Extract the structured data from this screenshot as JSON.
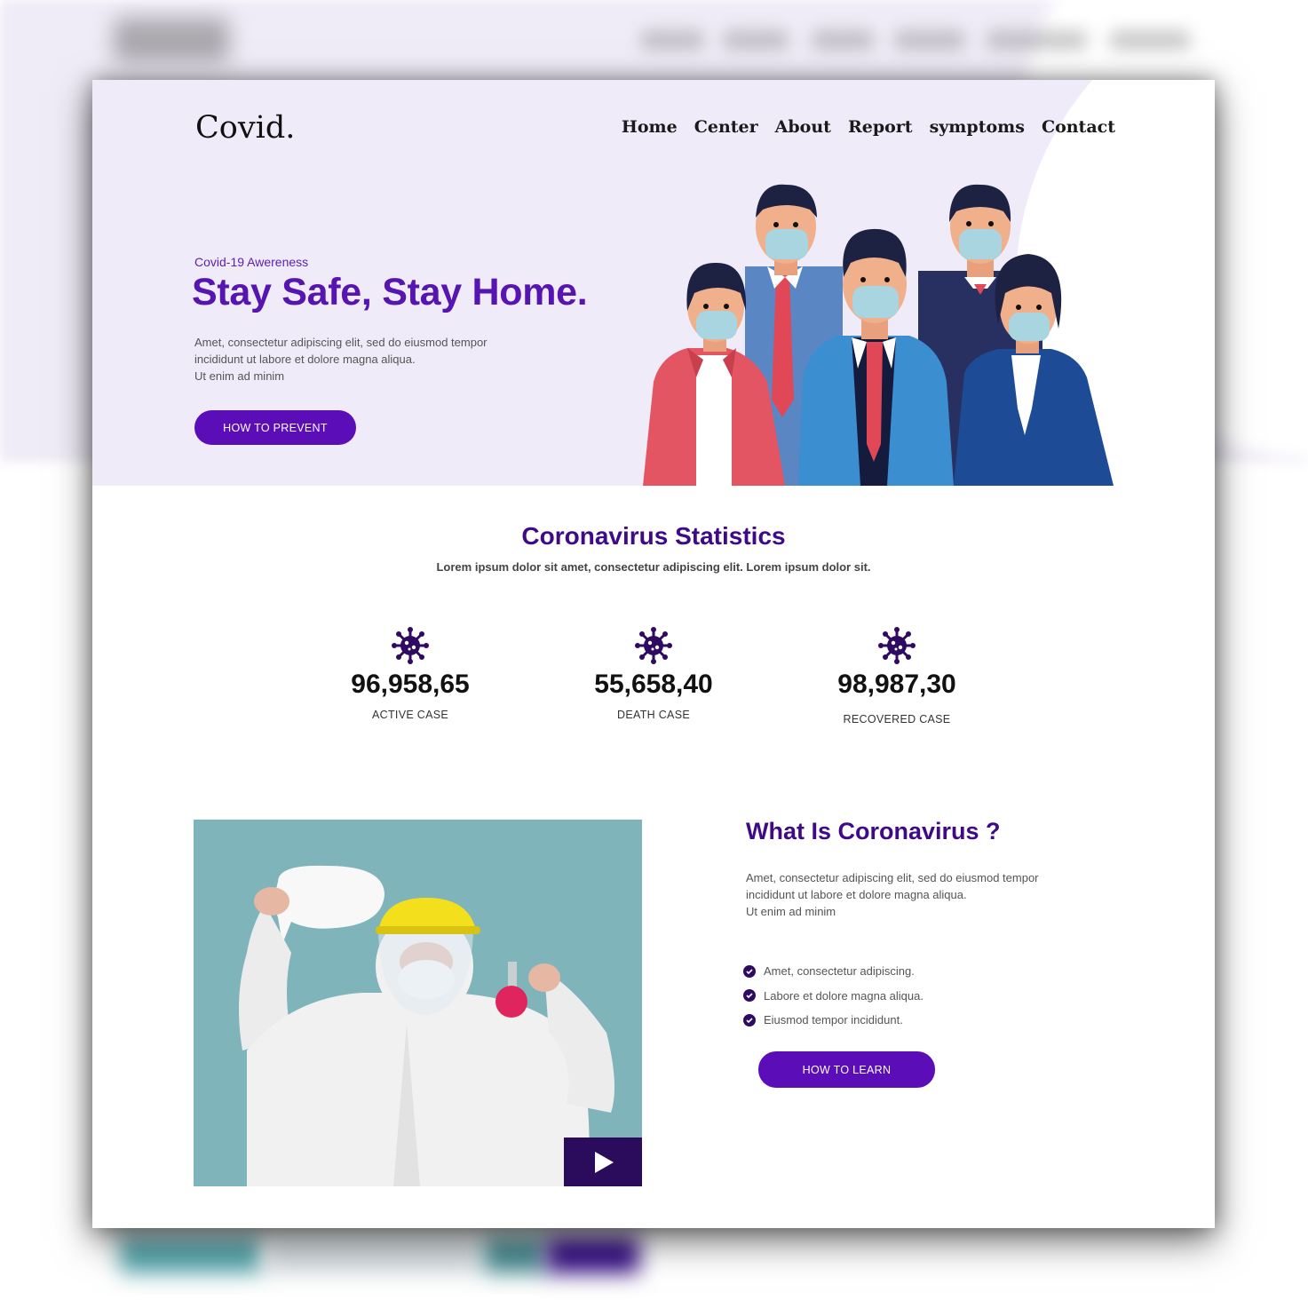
{
  "logo": "Covid.",
  "nav": [
    "Home",
    "Center",
    "About",
    "Report",
    "symptoms",
    "Contact"
  ],
  "hero": {
    "tagline": "Covid-19 Awereness",
    "title": "Stay Safe, Stay Home.",
    "desc_lines": [
      "Amet, consectetur adipiscing elit, sed do eiusmod tempor",
      "incididunt ut labore et dolore magna aliqua.",
      "Ut enim ad minim"
    ],
    "button": "HOW TO PREVENT"
  },
  "stats": {
    "title": "Coronavirus Statistics",
    "subtitle": "Lorem ipsum dolor sit amet, consectetur adipiscing elit. Lorem ipsum dolor sit.",
    "items": [
      {
        "value": "96,958,65",
        "label": "ACTIVE CASE",
        "icon": "virus-icon"
      },
      {
        "value": "55,658,40",
        "label": "DEATH CASE",
        "icon": "virus-icon"
      },
      {
        "value": "98,987,30",
        "label": "RECOVERED CASE",
        "icon": "virus-icon"
      }
    ]
  },
  "about": {
    "title": "What Is Coronavirus ?",
    "desc_lines": [
      "Amet, consectetur adipiscing elit, sed do eiusmod tempor",
      "incididunt ut labore et dolore magna aliqua.",
      "Ut enim ad minim"
    ],
    "checks": [
      "Amet, consectetur adipiscing.",
      "Labore et dolore magna aliqua.",
      "Eiusmod tempor incididunt."
    ],
    "button": "HOW TO LEARN"
  },
  "colors": {
    "accent": "#5b0db8",
    "heading": "#3f0a87",
    "hero_bg": "#efebf8",
    "dark": "#2b0b5b"
  }
}
